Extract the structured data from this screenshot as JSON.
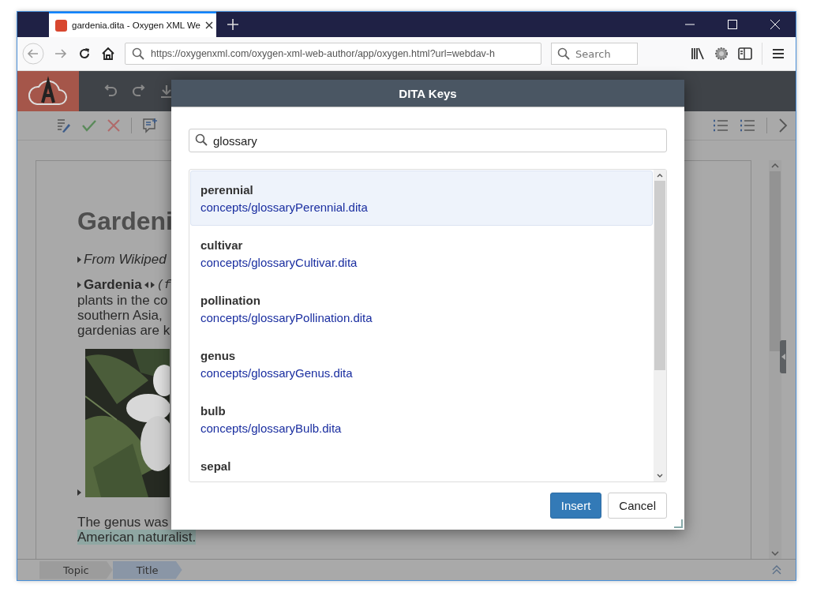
{
  "browser": {
    "tab_title": "gardenia.dita - Oxygen XML We",
    "url": "https://oxygenxml.com/oxygen-xml-web-author/app/oxygen.html?url=webdav-h",
    "search_placeholder": "Search"
  },
  "document": {
    "title": "Gardeni",
    "shortdesc": "From Wikiped",
    "term": "Gardenia",
    "term_tail": "(f",
    "para_lines": [
      "plants in the co",
      "southern Asia, ",
      "gardenias are k"
    ],
    "closing": "The genus was",
    "closing_highlight": "American naturalist."
  },
  "breadcrumbs": [
    {
      "label": "Topic",
      "selected": false
    },
    {
      "label": "Title",
      "selected": true
    }
  ],
  "dialog": {
    "title": "DITA Keys",
    "search_value": "glossary",
    "keys": [
      {
        "key": "perennial",
        "path": "concepts/glossaryPerennial.dita",
        "selected": true
      },
      {
        "key": "cultivar",
        "path": "concepts/glossaryCultivar.dita",
        "selected": false
      },
      {
        "key": "pollination",
        "path": "concepts/glossaryPollination.dita",
        "selected": false
      },
      {
        "key": "genus",
        "path": "concepts/glossaryGenus.dita",
        "selected": false
      },
      {
        "key": "bulb",
        "path": "concepts/glossaryBulb.dita",
        "selected": false
      },
      {
        "key": "sepal",
        "selected": false
      }
    ],
    "buttons": [
      {
        "label": "Insert",
        "kind": "primary"
      },
      {
        "label": "Cancel",
        "kind": "secondary"
      }
    ]
  }
}
